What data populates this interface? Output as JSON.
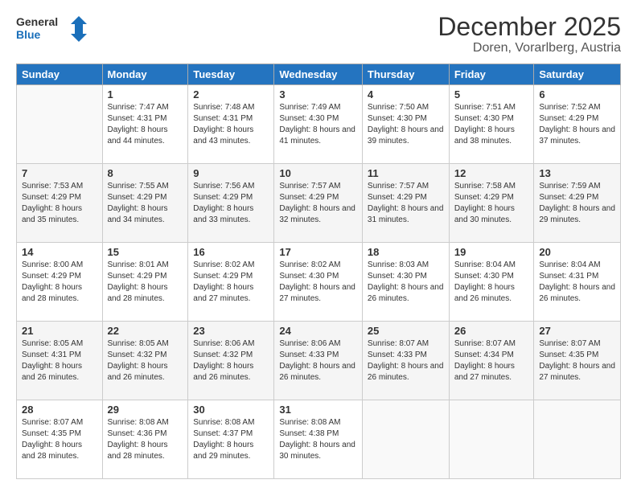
{
  "header": {
    "logo_line1": "General",
    "logo_line2": "Blue",
    "title": "December 2025",
    "subtitle": "Doren, Vorarlberg, Austria"
  },
  "weekdays": [
    "Sunday",
    "Monday",
    "Tuesday",
    "Wednesday",
    "Thursday",
    "Friday",
    "Saturday"
  ],
  "weeks": [
    [
      {
        "day": "",
        "sunrise": "",
        "sunset": "",
        "daylight": ""
      },
      {
        "day": "1",
        "sunrise": "7:47 AM",
        "sunset": "4:31 PM",
        "daylight": "8 hours and 44 minutes."
      },
      {
        "day": "2",
        "sunrise": "7:48 AM",
        "sunset": "4:31 PM",
        "daylight": "8 hours and 43 minutes."
      },
      {
        "day": "3",
        "sunrise": "7:49 AM",
        "sunset": "4:30 PM",
        "daylight": "8 hours and 41 minutes."
      },
      {
        "day": "4",
        "sunrise": "7:50 AM",
        "sunset": "4:30 PM",
        "daylight": "8 hours and 39 minutes."
      },
      {
        "day": "5",
        "sunrise": "7:51 AM",
        "sunset": "4:30 PM",
        "daylight": "8 hours and 38 minutes."
      },
      {
        "day": "6",
        "sunrise": "7:52 AM",
        "sunset": "4:29 PM",
        "daylight": "8 hours and 37 minutes."
      }
    ],
    [
      {
        "day": "7",
        "sunrise": "7:53 AM",
        "sunset": "4:29 PM",
        "daylight": "8 hours and 35 minutes."
      },
      {
        "day": "8",
        "sunrise": "7:55 AM",
        "sunset": "4:29 PM",
        "daylight": "8 hours and 34 minutes."
      },
      {
        "day": "9",
        "sunrise": "7:56 AM",
        "sunset": "4:29 PM",
        "daylight": "8 hours and 33 minutes."
      },
      {
        "day": "10",
        "sunrise": "7:57 AM",
        "sunset": "4:29 PM",
        "daylight": "8 hours and 32 minutes."
      },
      {
        "day": "11",
        "sunrise": "7:57 AM",
        "sunset": "4:29 PM",
        "daylight": "8 hours and 31 minutes."
      },
      {
        "day": "12",
        "sunrise": "7:58 AM",
        "sunset": "4:29 PM",
        "daylight": "8 hours and 30 minutes."
      },
      {
        "day": "13",
        "sunrise": "7:59 AM",
        "sunset": "4:29 PM",
        "daylight": "8 hours and 29 minutes."
      }
    ],
    [
      {
        "day": "14",
        "sunrise": "8:00 AM",
        "sunset": "4:29 PM",
        "daylight": "8 hours and 28 minutes."
      },
      {
        "day": "15",
        "sunrise": "8:01 AM",
        "sunset": "4:29 PM",
        "daylight": "8 hours and 28 minutes."
      },
      {
        "day": "16",
        "sunrise": "8:02 AM",
        "sunset": "4:29 PM",
        "daylight": "8 hours and 27 minutes."
      },
      {
        "day": "17",
        "sunrise": "8:02 AM",
        "sunset": "4:30 PM",
        "daylight": "8 hours and 27 minutes."
      },
      {
        "day": "18",
        "sunrise": "8:03 AM",
        "sunset": "4:30 PM",
        "daylight": "8 hours and 26 minutes."
      },
      {
        "day": "19",
        "sunrise": "8:04 AM",
        "sunset": "4:30 PM",
        "daylight": "8 hours and 26 minutes."
      },
      {
        "day": "20",
        "sunrise": "8:04 AM",
        "sunset": "4:31 PM",
        "daylight": "8 hours and 26 minutes."
      }
    ],
    [
      {
        "day": "21",
        "sunrise": "8:05 AM",
        "sunset": "4:31 PM",
        "daylight": "8 hours and 26 minutes."
      },
      {
        "day": "22",
        "sunrise": "8:05 AM",
        "sunset": "4:32 PM",
        "daylight": "8 hours and 26 minutes."
      },
      {
        "day": "23",
        "sunrise": "8:06 AM",
        "sunset": "4:32 PM",
        "daylight": "8 hours and 26 minutes."
      },
      {
        "day": "24",
        "sunrise": "8:06 AM",
        "sunset": "4:33 PM",
        "daylight": "8 hours and 26 minutes."
      },
      {
        "day": "25",
        "sunrise": "8:07 AM",
        "sunset": "4:33 PM",
        "daylight": "8 hours and 26 minutes."
      },
      {
        "day": "26",
        "sunrise": "8:07 AM",
        "sunset": "4:34 PM",
        "daylight": "8 hours and 27 minutes."
      },
      {
        "day": "27",
        "sunrise": "8:07 AM",
        "sunset": "4:35 PM",
        "daylight": "8 hours and 27 minutes."
      }
    ],
    [
      {
        "day": "28",
        "sunrise": "8:07 AM",
        "sunset": "4:35 PM",
        "daylight": "8 hours and 28 minutes."
      },
      {
        "day": "29",
        "sunrise": "8:08 AM",
        "sunset": "4:36 PM",
        "daylight": "8 hours and 28 minutes."
      },
      {
        "day": "30",
        "sunrise": "8:08 AM",
        "sunset": "4:37 PM",
        "daylight": "8 hours and 29 minutes."
      },
      {
        "day": "31",
        "sunrise": "8:08 AM",
        "sunset": "4:38 PM",
        "daylight": "8 hours and 30 minutes."
      },
      {
        "day": "",
        "sunrise": "",
        "sunset": "",
        "daylight": ""
      },
      {
        "day": "",
        "sunrise": "",
        "sunset": "",
        "daylight": ""
      },
      {
        "day": "",
        "sunrise": "",
        "sunset": "",
        "daylight": ""
      }
    ]
  ]
}
